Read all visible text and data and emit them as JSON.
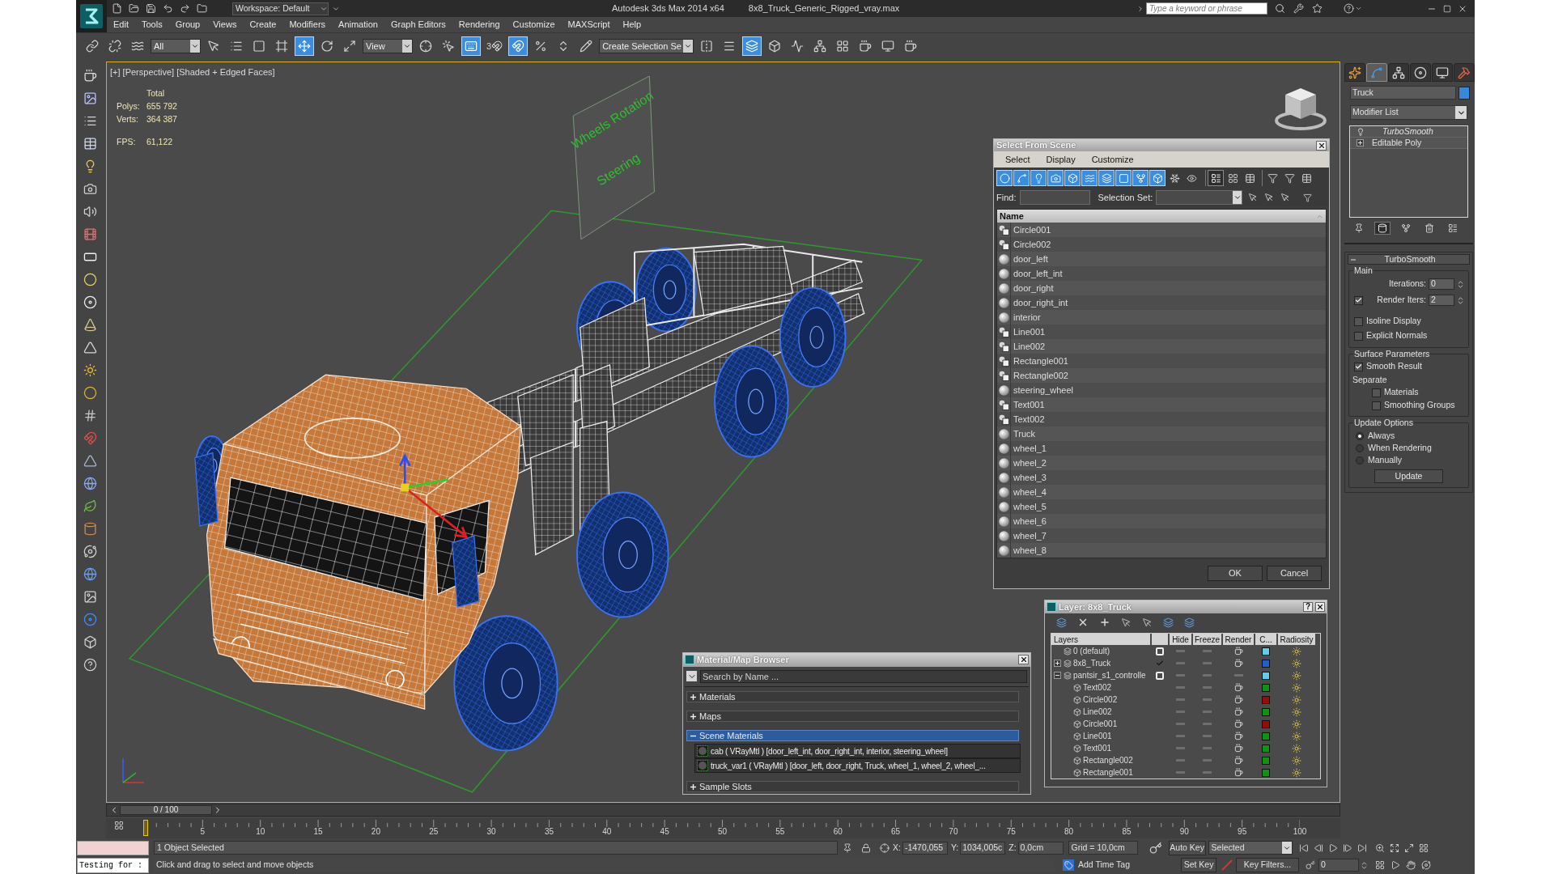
{
  "title_bar": {
    "workspace": "Workspace: Default",
    "app_title": "Autodesk 3ds Max 2014 x64",
    "file_name": "8x8_Truck_Generic_Rigged_vray.max",
    "search_placeholder": "Type a keyword or phrase"
  },
  "menu_bar": [
    "Edit",
    "Tools",
    "Group",
    "Views",
    "Create",
    "Modifiers",
    "Animation",
    "Graph Editors",
    "Rendering",
    "Customize",
    "MAXScript",
    "Help"
  ],
  "main_toolbar": [
    {
      "kind": "link",
      "selected": false
    },
    {
      "kind": "unlink",
      "selected": false
    },
    {
      "kind": "bind",
      "selected": false
    },
    {
      "kind": "dropdown",
      "value": "All"
    },
    {
      "kind": "select",
      "selected": false
    },
    {
      "kind": "select_by_name",
      "selected": false
    },
    {
      "kind": "region",
      "selected": false
    },
    {
      "kind": "window_crossing",
      "selected": false
    },
    {
      "kind": "move",
      "selected": true
    },
    {
      "kind": "rotate",
      "selected": false
    },
    {
      "kind": "scale",
      "selected": false
    },
    {
      "kind": "dropdown",
      "value": "View"
    },
    {
      "kind": "pivot",
      "selected": false
    },
    {
      "kind": "manipulate",
      "selected": false
    },
    {
      "kind": "keyboard",
      "selected": true
    },
    {
      "kind": "snap",
      "label": "3",
      "selected": false
    },
    {
      "kind": "angle_snap",
      "selected": true
    },
    {
      "kind": "percent_snap",
      "selected": false
    },
    {
      "kind": "spinner_snap",
      "selected": false
    },
    {
      "kind": "named_sets",
      "selected": false
    },
    {
      "kind": "dropdown",
      "value": "Create Selection Se"
    },
    {
      "kind": "mirror",
      "selected": false
    },
    {
      "kind": "align",
      "selected": false
    },
    {
      "kind": "layers",
      "selected": true
    },
    {
      "kind": "graphite",
      "selected": false
    },
    {
      "kind": "curve_editor",
      "selected": false
    },
    {
      "kind": "schematic",
      "selected": false
    },
    {
      "kind": "material_editor",
      "selected": false
    },
    {
      "kind": "render_setup",
      "selected": false
    },
    {
      "kind": "frame_window",
      "selected": false
    },
    {
      "kind": "render",
      "selected": false
    }
  ],
  "viewport": {
    "label": "[+] [Perspective] [Shaded + Edged Faces]",
    "stats_heading": "Total",
    "stats": [
      {
        "label": "Polys:",
        "value": "655 792"
      },
      {
        "label": "Verts:",
        "value": "364 387"
      }
    ],
    "fps": {
      "label": "FPS:",
      "value": "61,122"
    },
    "scene_texts": [
      "Wheels Rotation",
      "Steering"
    ]
  },
  "command_panel": {
    "tabs": [
      {
        "kind": "create",
        "selected": false
      },
      {
        "kind": "modify",
        "selected": true
      },
      {
        "kind": "hierarchy",
        "selected": false
      },
      {
        "kind": "motion",
        "selected": false
      },
      {
        "kind": "display",
        "selected": false
      },
      {
        "kind": "utilities",
        "selected": false
      }
    ],
    "object_name": "Truck",
    "modifier_list": "Modifier List",
    "modifier_stack": [
      {
        "name": "TurboSmooth",
        "kind": "modifier",
        "viewport_on": false
      },
      {
        "name": "Editable Poly",
        "kind": "base",
        "expanded": false
      }
    ],
    "stack_tools": [
      {
        "kind": "pin",
        "selected": false
      },
      {
        "kind": "show_end_result",
        "selected": true
      },
      {
        "kind": "make_unique",
        "selected": false
      },
      {
        "kind": "remove",
        "selected": false
      },
      {
        "kind": "configure",
        "selected": false
      }
    ],
    "rollout": {
      "title": "TurboSmooth",
      "expanded": true,
      "groups": [
        {
          "title": "Main",
          "controls": [
            {
              "kind": "spinner",
              "label": "Iterations:",
              "value": "0"
            },
            {
              "kind": "check_spinner",
              "label": "Render Iters:",
              "checked": true,
              "value": "2"
            },
            {
              "kind": "checkbox",
              "label": "Isoline Display",
              "checked": false
            },
            {
              "kind": "checkbox",
              "label": "Explicit Normals",
              "checked": false
            }
          ]
        },
        {
          "title": "Surface Parameters",
          "controls": [
            {
              "kind": "checkbox",
              "label": "Smooth Result",
              "checked": true
            },
            {
              "kind": "label",
              "label": "Separate"
            },
            {
              "kind": "sub_checkbox",
              "label": "Materials",
              "checked": false
            },
            {
              "kind": "sub_checkbox",
              "label": "Smoothing Groups",
              "checked": false
            }
          ]
        },
        {
          "title": "Update Options",
          "controls": [
            {
              "kind": "radio",
              "label": "Always",
              "selected": true
            },
            {
              "kind": "radio",
              "label": "When Rendering",
              "selected": false
            },
            {
              "kind": "radio",
              "label": "Manually",
              "selected": false
            },
            {
              "kind": "button",
              "label": "Update"
            }
          ]
        }
      ]
    }
  },
  "select_from_scene": {
    "title": "Select From Scene",
    "menus": [
      "Select",
      "Display",
      "Customize"
    ],
    "filters": [
      {
        "kind": "geometry",
        "selected": true
      },
      {
        "kind": "shapes",
        "selected": true
      },
      {
        "kind": "lights",
        "selected": true
      },
      {
        "kind": "cameras",
        "selected": true
      },
      {
        "kind": "helpers",
        "selected": true
      },
      {
        "kind": "space_warps",
        "selected": true
      },
      {
        "kind": "groups",
        "selected": true
      },
      {
        "kind": "xrefs",
        "selected": true
      },
      {
        "kind": "bones",
        "selected": true
      },
      {
        "kind": "containers",
        "selected": true
      },
      {
        "kind": "frozen",
        "selected": false
      },
      {
        "kind": "hidden",
        "selected": false
      }
    ],
    "display_modes": [
      {
        "kind": "list",
        "selected": true
      },
      {
        "kind": "icons",
        "selected": false
      },
      {
        "kind": "details",
        "selected": false
      }
    ],
    "find_label": "Find:",
    "selection_set_label": "Selection Set:",
    "column": "Name",
    "objects": [
      {
        "name": "Circle001",
        "kind": "shape"
      },
      {
        "name": "Circle002",
        "kind": "shape"
      },
      {
        "name": "door_left",
        "kind": "geometry"
      },
      {
        "name": "door_left_int",
        "kind": "geometry"
      },
      {
        "name": "door_right",
        "kind": "geometry"
      },
      {
        "name": "door_right_int",
        "kind": "geometry"
      },
      {
        "name": "interior",
        "kind": "geometry"
      },
      {
        "name": "Line001",
        "kind": "shape"
      },
      {
        "name": "Line002",
        "kind": "shape"
      },
      {
        "name": "Rectangle001",
        "kind": "shape"
      },
      {
        "name": "Rectangle002",
        "kind": "shape"
      },
      {
        "name": "steering_wheel",
        "kind": "geometry"
      },
      {
        "name": "Text001",
        "kind": "shape"
      },
      {
        "name": "Text002",
        "kind": "shape"
      },
      {
        "name": "Truck",
        "kind": "geometry"
      },
      {
        "name": "wheel_1",
        "kind": "geometry"
      },
      {
        "name": "wheel_2",
        "kind": "geometry"
      },
      {
        "name": "wheel_3",
        "kind": "geometry"
      },
      {
        "name": "wheel_4",
        "kind": "geometry"
      },
      {
        "name": "wheel_5",
        "kind": "geometry"
      },
      {
        "name": "wheel_6",
        "kind": "geometry"
      },
      {
        "name": "wheel_7",
        "kind": "geometry"
      },
      {
        "name": "wheel_8",
        "kind": "geometry"
      }
    ],
    "buttons": [
      "OK",
      "Cancel"
    ]
  },
  "layer_manager": {
    "title": "Layer: 8x8_Truck",
    "help_button": "?",
    "columns": [
      "Layers",
      "Hide",
      "Freeze",
      "Render",
      "C...",
      "Radiosity"
    ],
    "layers": [
      {
        "name": "0 (default)",
        "kind": "layer",
        "current": false,
        "hidden": false,
        "frozen": false,
        "renderable": true,
        "color": "#5ccff0"
      },
      {
        "name": "8x8_Truck",
        "kind": "layer",
        "expanded": false,
        "current": true,
        "hidden": false,
        "frozen": false,
        "renderable": true,
        "color": "#1f5fcf"
      },
      {
        "name": "pantsir_s1_controlle",
        "kind": "layer",
        "expanded": true,
        "current": false,
        "hidden": false,
        "frozen": false,
        "renderable": false,
        "color": "#5ccff0",
        "children": [
          {
            "name": "Text002",
            "kind": "object",
            "hidden": false,
            "frozen": false,
            "renderable": true,
            "color": "#0e940e"
          },
          {
            "name": "Circle002",
            "kind": "object",
            "hidden": false,
            "frozen": false,
            "renderable": true,
            "color": "#9a0a0a"
          },
          {
            "name": "Line002",
            "kind": "object",
            "hidden": false,
            "frozen": false,
            "renderable": true,
            "color": "#0e940e"
          },
          {
            "name": "Circle001",
            "kind": "object",
            "hidden": false,
            "frozen": false,
            "renderable": true,
            "color": "#9a0a0a"
          },
          {
            "name": "Line001",
            "kind": "object",
            "hidden": false,
            "frozen": false,
            "renderable": true,
            "color": "#0e940e"
          },
          {
            "name": "Text001",
            "kind": "object",
            "hidden": false,
            "frozen": false,
            "renderable": true,
            "color": "#0e940e"
          },
          {
            "name": "Rectangle002",
            "kind": "object",
            "hidden": false,
            "frozen": false,
            "renderable": true,
            "color": "#0e940e"
          },
          {
            "name": "Rectangle001",
            "kind": "object",
            "hidden": false,
            "frozen": false,
            "renderable": true,
            "color": "#0e940e"
          }
        ]
      }
    ]
  },
  "material_browser": {
    "title": "Material/Map Browser",
    "search_placeholder": "Search by Name ...",
    "groups": [
      {
        "label": "Materials",
        "expanded": false,
        "selected": false
      },
      {
        "label": "Maps",
        "expanded": false,
        "selected": false
      },
      {
        "label": "Scene Materials",
        "expanded": true,
        "selected": true,
        "items": [
          "cab ( VRayMtl ) [door_left_int, door_right_int, interior, steering_wheel]",
          "truck_var1 ( VRayMtl ) [door_left, door_right, Truck, wheel_1, wheel_2, wheel_..."
        ]
      },
      {
        "label": "Sample Slots",
        "expanded": false,
        "selected": false
      }
    ]
  },
  "time_slider": {
    "label": "0 / 100",
    "level": 0
  },
  "track_bar": {
    "ticks": [
      "5",
      "10",
      "15",
      "20",
      "25",
      "30",
      "35",
      "40",
      "45",
      "50",
      "55",
      "60",
      "65",
      "70",
      "75",
      "80",
      "85",
      "90",
      "95",
      "100"
    ]
  },
  "status_bar": {
    "listener_output": "Testing for :",
    "selection": "1 Object Selected",
    "prompt": "Click and drag to select and move objects",
    "coords": [
      {
        "axis": "X:",
        "value": "-1470,055"
      },
      {
        "axis": "Y:",
        "value": "1034,005c"
      },
      {
        "axis": "Z:",
        "value": "0,0cm"
      }
    ],
    "grid": "Grid = 10,0cm",
    "add_time_tag": "Add Time Tag",
    "auto_key": "Auto Key",
    "key_mode": "Selected",
    "set_key": "Set Key",
    "key_filters": "Key Filters...",
    "frame": "0"
  }
}
